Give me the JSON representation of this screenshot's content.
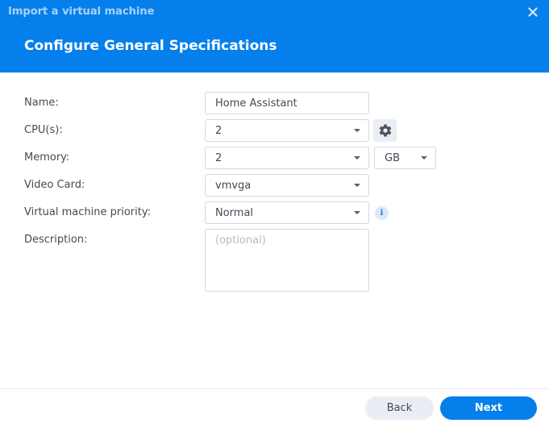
{
  "window": {
    "title": "Import a virtual machine",
    "close_icon": "close-icon"
  },
  "header": {
    "title": "Configure General Specifications"
  },
  "form": {
    "name": {
      "label": "Name:",
      "value": "Home Assistant"
    },
    "cpu": {
      "label": "CPU(s):",
      "value": "2",
      "settings_icon": "gear-icon"
    },
    "memory": {
      "label": "Memory:",
      "value": "2",
      "unit": "GB"
    },
    "video_card": {
      "label": "Video Card:",
      "value": "vmvga"
    },
    "priority": {
      "label": "Virtual machine priority:",
      "value": "Normal",
      "info_icon": "info-icon"
    },
    "description": {
      "label": "Description:",
      "value": "",
      "placeholder": "(optional)"
    }
  },
  "footer": {
    "back_label": "Back",
    "next_label": "Next"
  },
  "colors": {
    "accent": "#057feb",
    "secondary_button": "#e9eef4"
  }
}
